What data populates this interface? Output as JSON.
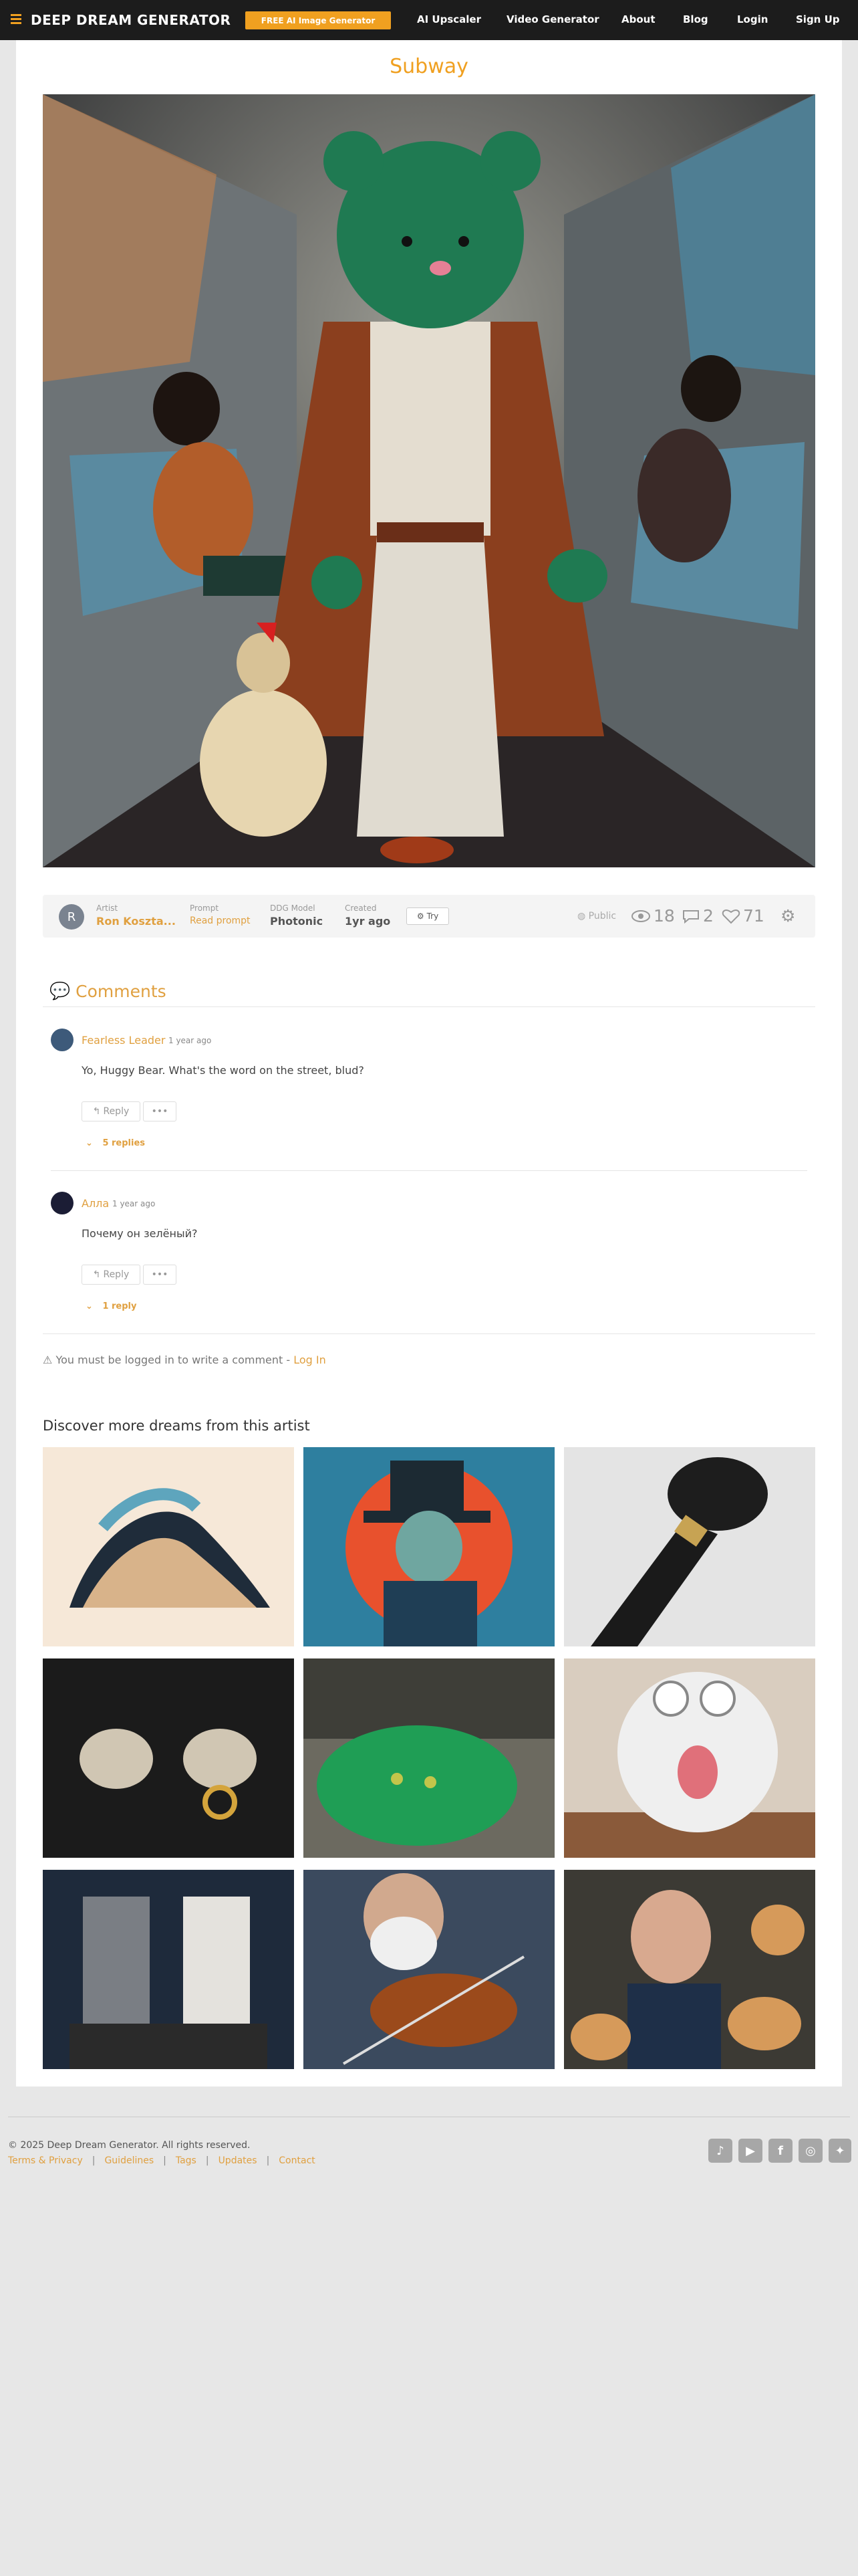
{
  "nav": {
    "brand": "DEEP DREAM GENERATOR",
    "cta": "FREE AI Image Generator",
    "links": [
      "AI Upscaler",
      "Video Generator",
      "About",
      "Blog",
      "Login",
      "Sign Up"
    ]
  },
  "dream": {
    "title": "Subway",
    "artist_label": "Artist",
    "artist": "Ron Koszta...",
    "artist_initial": "R",
    "prompt_label": "Prompt",
    "prompt_link": "Read prompt",
    "model_label": "DDG Model",
    "model": "Photonic",
    "created_label": "Created",
    "created": "1yr ago",
    "try_label": "Try",
    "visibility": "Public",
    "views": "18",
    "comments": "2",
    "likes": "71"
  },
  "comments": {
    "heading": "Comments",
    "items": [
      {
        "user": "Fearless Leader",
        "time": "1 year ago",
        "text": "Yo, Huggy Bear.  What's the word on the street, blud?",
        "reply": "Reply",
        "more": "•••",
        "replies": "5 replies"
      },
      {
        "user": "Алла",
        "time": "1 year ago",
        "text": "Почему он зелёный?",
        "reply": "Reply",
        "more": "•••",
        "replies": "1 reply"
      }
    ],
    "login_notice": "You must be logged in to write a comment - ",
    "login_link": "Log In"
  },
  "discover": {
    "heading": "Discover more dreams from this artist"
  },
  "footer": {
    "copyright": "© 2025 Deep Dream Generator. All rights reserved.",
    "links": [
      "Terms & Privacy",
      "Guidelines",
      "Tags",
      "Updates",
      "Contact"
    ],
    "social": [
      "tiktok-icon",
      "youtube-icon",
      "facebook-icon",
      "instagram-icon",
      "twitter-icon"
    ]
  },
  "colors": {
    "accent": "#f0a020",
    "nav_bg": "#1c1c1c",
    "page_bg": "#e7e7e7"
  }
}
